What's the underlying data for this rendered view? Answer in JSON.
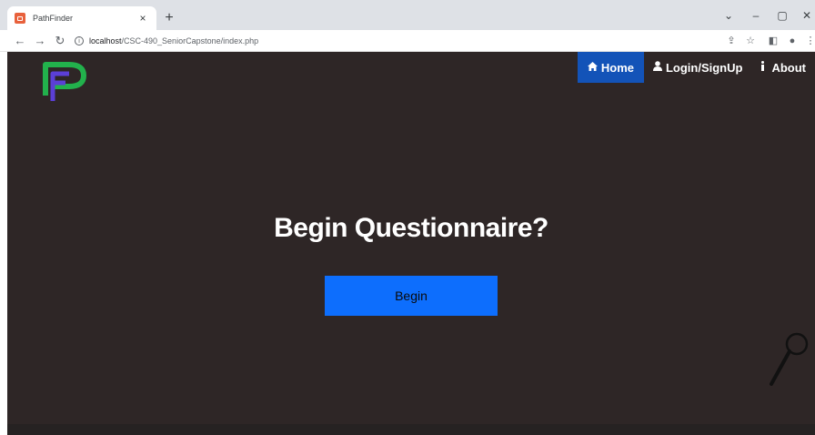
{
  "browser": {
    "tab_title": "PathFinder",
    "tab_close": "×",
    "new_tab": "+",
    "url_host": "localhost",
    "url_path": "/CSC-490_SeniorCapstone/index.php",
    "window_controls": [
      "⌄",
      "–",
      "▢",
      "✕"
    ]
  },
  "site": {
    "nav": {
      "home": "Home",
      "login": "Login/SignUp",
      "about": "About"
    },
    "heading": "Begin Questionnaire?",
    "begin_label": "Begin",
    "colors": {
      "background": "#2e2626",
      "nav_active": "#1353b8",
      "button": "#0d6efd",
      "logo_green": "#22b14c",
      "logo_purple": "#5b3fd6"
    }
  }
}
